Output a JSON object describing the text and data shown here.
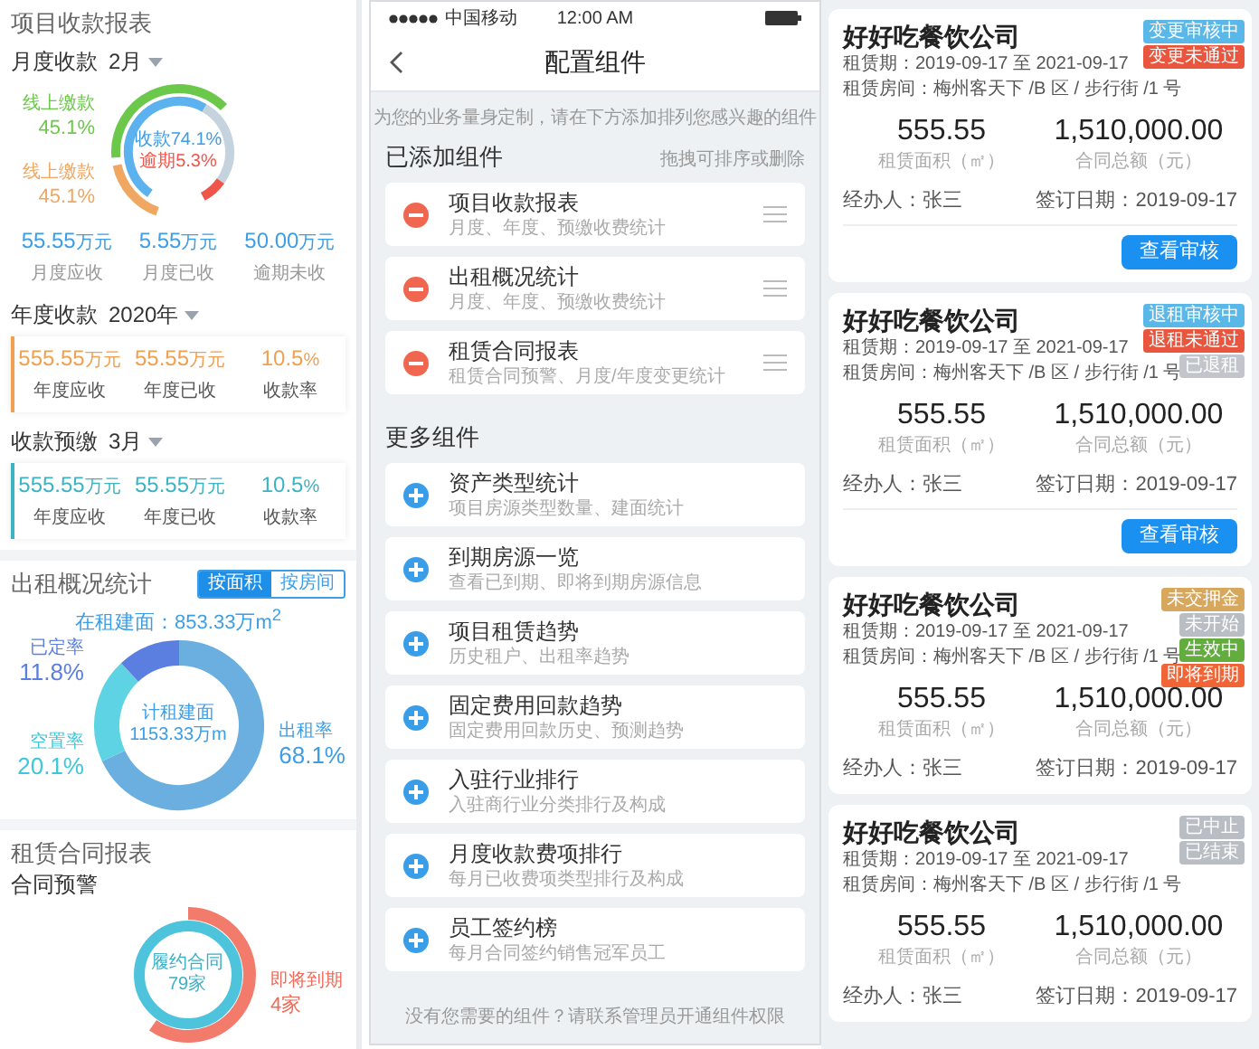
{
  "collection_report": {
    "title": "项目收款报表",
    "monthly": {
      "label": "月度收款",
      "period": "2月",
      "ring_labels": [
        {
          "label": "线上缴款",
          "value": "45.1%",
          "color": "#6cc84a"
        },
        {
          "label": "线上缴款",
          "value": "45.1%",
          "color": "#f0a762"
        }
      ],
      "center": [
        {
          "text": "收款74.1%",
          "color": "#3d9de6"
        },
        {
          "text": "逾期5.3%",
          "color": "#f0554a"
        }
      ],
      "stats": [
        {
          "value": "55.55",
          "unit": "万元",
          "label": "月度应收"
        },
        {
          "value": "5.55",
          "unit": "万元",
          "label": "月度已收"
        },
        {
          "value": "50.00",
          "unit": "万元",
          "label": "逾期未收"
        }
      ]
    },
    "yearly": {
      "label": "年度收款",
      "period": "2020年",
      "stats": [
        {
          "value": "555.55",
          "unit": "万元",
          "label": "年度应收"
        },
        {
          "value": "55.55",
          "unit": "万元",
          "label": "年度已收"
        },
        {
          "value": "10.5",
          "unit": "%",
          "label": "收款率"
        }
      ]
    },
    "prepaid": {
      "label": "收款预缴",
      "period": "3月",
      "stats": [
        {
          "value": "555.55",
          "unit": "万元",
          "label": "年度应收"
        },
        {
          "value": "55.55",
          "unit": "万元",
          "label": "年度已收"
        },
        {
          "value": "10.5",
          "unit": "%",
          "label": "收款率"
        }
      ]
    }
  },
  "leasing_overview": {
    "title": "出租概况统计",
    "toggle": [
      {
        "label": "按面积",
        "selected": true
      },
      {
        "label": "按房间",
        "selected": false
      }
    ],
    "occupied_area": "在租建面：853.33万m$^{2}$",
    "center": [
      "计租建面",
      "1153.33万m"
    ],
    "callouts": [
      {
        "label": "已定率",
        "value": "11.8%",
        "color": "#5b7fe0"
      },
      {
        "label": "空置率",
        "value": "20.1%",
        "color": "#3ec6dc"
      },
      {
        "label": "出租率",
        "value": "68.1%",
        "color": "#3d9de6"
      }
    ]
  },
  "contract_report": {
    "title": "租赁合同报表",
    "subtitle": "合同预警",
    "center": [
      "履约合同",
      "79家"
    ],
    "callout": {
      "label": "即将到期",
      "value": "4家"
    }
  },
  "config": {
    "status_bar": {
      "carrier": "中国移动",
      "time": "12:00 AM"
    },
    "title": "配置组件",
    "hint": "为您的业务量身定制，请在下方添加排列您感兴趣的组件",
    "added": {
      "title": "已添加组件",
      "hint": "拖拽可排序或删除",
      "items": [
        {
          "title": "项目收款报表",
          "description": "月度、年度、预缴收费统计"
        },
        {
          "title": "出租概况统计",
          "description": "月度、年度、预缴收费统计"
        },
        {
          "title": "租赁合同报表",
          "description": "租赁合同预警、月度/年度变更统计"
        }
      ]
    },
    "more": {
      "title": "更多组件",
      "items": [
        {
          "title": "资产类型统计",
          "description": "项目房源类型数量、建面统计"
        },
        {
          "title": "到期房源一览",
          "description": "查看已到期、即将到期房源信息"
        },
        {
          "title": "项目租赁趋势",
          "description": "历史租户、出租率趋势"
        },
        {
          "title": "固定费用回款趋势",
          "description": "固定费用回款历史、预测趋势"
        },
        {
          "title": "入驻行业排行",
          "description": "入驻商行业分类排行及构成"
        },
        {
          "title": "月度收款费项排行",
          "description": "每月已收费项类型排行及构成"
        },
        {
          "title": "员工签约榜",
          "description": "每月合同签约销售冠军员工"
        }
      ]
    },
    "footer": "没有您需要的组件？请联系管理员开通组件权限"
  },
  "contracts": [
    {
      "company": "好好吃餐饮公司",
      "period": "租赁期：2019-09-17 至 2021-09-17",
      "room": "租赁房间：梅州客天下 /B 区 / 步行街 /1 号",
      "area": "555.55",
      "area_label": "租赁面积（㎡）",
      "amount": "1,510,000.00",
      "amount_label": "合同总额（元）",
      "handler": "经办人：张三",
      "signed": "签订日期：2019-09-17",
      "tags": [
        {
          "label": "变更审核中",
          "color": "#5ab8e8"
        },
        {
          "label": "变更未通过",
          "color": "#e9553d"
        }
      ],
      "action": "查看审核"
    },
    {
      "company": "好好吃餐饮公司",
      "period": "租赁期：2019-09-17 至 2021-09-17",
      "room": "租赁房间：梅州客天下 /B 区 / 步行街 /1 号",
      "area": "555.55",
      "area_label": "租赁面积（㎡）",
      "amount": "1,510,000.00",
      "amount_label": "合同总额（元）",
      "handler": "经办人：张三",
      "signed": "签订日期：2019-09-17",
      "tags": [
        {
          "label": "退租审核中",
          "color": "#5ab8e8"
        },
        {
          "label": "退租未通过",
          "color": "#e9553d"
        },
        {
          "label": "已退租",
          "color": "#c2c6cc"
        }
      ],
      "action": "查看审核"
    },
    {
      "company": "好好吃餐饮公司",
      "period": "租赁期：2019-09-17 至 2021-09-17",
      "room": "租赁房间：梅州客天下 /B 区 / 步行街 /1 号",
      "area": "555.55",
      "area_label": "租赁面积（㎡）",
      "amount": "1,510,000.00",
      "amount_label": "合同总额（元）",
      "handler": "经办人：张三",
      "signed": "签订日期：2019-09-17",
      "tags": [
        {
          "label": "未交押金",
          "color": "#d8a75e"
        },
        {
          "label": "未开始",
          "color": "#b9bdc4"
        },
        {
          "label": "生效中",
          "color": "#63ad3f"
        },
        {
          "label": "即将到期",
          "color": "#f06436"
        }
      ]
    },
    {
      "company": "好好吃餐饮公司",
      "period": "租赁期：2019-09-17 至 2021-09-17",
      "room": "租赁房间：梅州客天下 /B 区 / 步行街 /1 号",
      "area": "555.55",
      "area_label": "租赁面积（㎡）",
      "amount": "1,510,000.00",
      "amount_label": "合同总额（元）",
      "handler": "经办人：张三",
      "signed": "签订日期：2019-09-17",
      "tags": [
        {
          "label": "已中止",
          "color": "#b9bdc4"
        },
        {
          "label": "已结束",
          "color": "#b9bdc4"
        }
      ]
    }
  ]
}
